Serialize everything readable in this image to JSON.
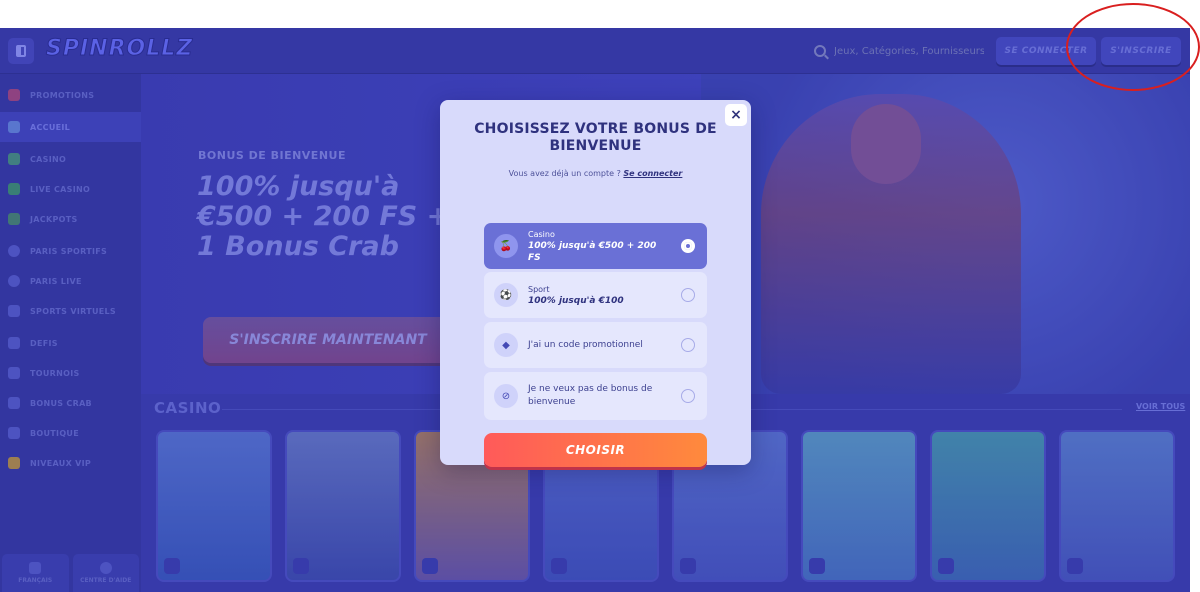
{
  "header": {
    "logo": "SPINROLLZ",
    "search_placeholder": "Jeux, Catégories, Fournisseurs",
    "login_label": "SE CONNECTER",
    "signup_label": "S'INSCRIRE"
  },
  "sidebar": {
    "items": [
      {
        "label": "PROMOTIONS",
        "icon": "gift-icon"
      },
      {
        "label": "ACCUEIL",
        "icon": "home-icon",
        "active": true
      },
      {
        "label": "CASINO",
        "icon": "slot-icon"
      },
      {
        "label": "LIVE CASINO",
        "icon": "live-icon"
      },
      {
        "label": "JACKPOTS",
        "icon": "jackpot-icon"
      },
      {
        "label": "PARIS SPORTIFS",
        "icon": "ball-icon"
      },
      {
        "label": "PARIS LIVE",
        "icon": "live-bet-icon"
      },
      {
        "label": "SPORTS VIRTUELS",
        "icon": "gamepad-icon"
      },
      {
        "label": "DEFIS",
        "icon": "trophy-icon"
      },
      {
        "label": "TOURNOIS",
        "icon": "cup-icon"
      },
      {
        "label": "BONUS CRAB",
        "icon": "crab-icon"
      },
      {
        "label": "BOUTIQUE",
        "icon": "shop-icon"
      },
      {
        "label": "NIVEAUX VIP",
        "icon": "crown-icon"
      }
    ],
    "footer": {
      "language_label": "FRANÇAIS",
      "help_label": "CENTRE D'AIDE"
    }
  },
  "hero": {
    "label": "BONUS DE BIENVENUE",
    "title": "100% jusqu'à €500 + 200 FS + 1 Bonus Crab",
    "cta": "S'INSCRIRE MAINTENANT"
  },
  "casino": {
    "title": "CASINO",
    "see_all": "VOIR TOUS",
    "games": [
      {
        "color_top": "#5b7bd6",
        "color_bottom": "#3a5cc0"
      },
      {
        "color_top": "#6a7fc9",
        "color_bottom": "#3f4fb0"
      },
      {
        "color_top": "#b8875a",
        "color_bottom": "#6d5aa8"
      },
      {
        "color_top": "#5a6fd0",
        "color_bottom": "#4256c0"
      },
      {
        "color_top": "#5e7ad4",
        "color_bottom": "#4a5ac4"
      },
      {
        "color_top": "#5fa6c8",
        "color_bottom": "#4a78c6"
      },
      {
        "color_top": "#4aa0b0",
        "color_bottom": "#3f6fb8"
      },
      {
        "color_top": "#5d86d2",
        "color_bottom": "#4a5cc2"
      }
    ]
  },
  "modal": {
    "close_label": "×",
    "title": "CHOISISSEZ VOTRE BONUS DE BIENVENUE",
    "subtitle": "Vous avez déjà un compte ?",
    "login_link": "Se connecter",
    "options": [
      {
        "label": "Casino",
        "desc": "100% jusqu'à €500 + 200 FS",
        "icon": "cherry-icon",
        "selected": true
      },
      {
        "label": "Sport",
        "desc": "100% jusqu'à €100",
        "icon": "soccer-ball-icon",
        "selected": false
      },
      {
        "single": "J'ai un code promotionnel",
        "icon": "ticket-icon",
        "selected": false
      },
      {
        "single": "Je ne veux pas de bonus de bienvenue",
        "icon": "no-icon",
        "selected": false
      }
    ],
    "choose_label": "CHOISIR"
  },
  "colors": {
    "page_bg": "#3c3fb0",
    "modal_bg": "#d8dafb",
    "selected_option": "#6a70d6",
    "cta_gradient_start": "#ff5a5a",
    "cta_gradient_end": "#ff8a3c",
    "annotation": "#d91f1f"
  }
}
